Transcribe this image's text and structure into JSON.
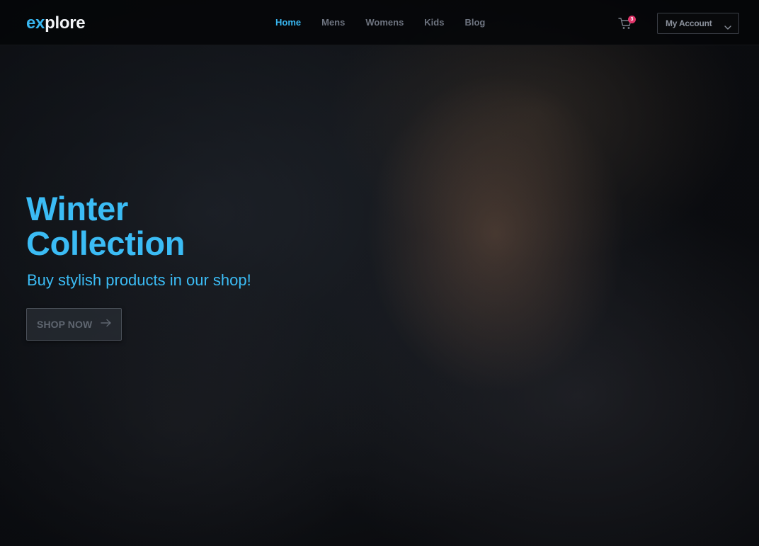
{
  "header": {
    "logo_prefix": "ex",
    "logo_rest": "plore",
    "nav": [
      {
        "label": "Home",
        "active": true
      },
      {
        "label": "Mens",
        "active": false
      },
      {
        "label": "Womens",
        "active": false
      },
      {
        "label": "Kids",
        "active": false
      },
      {
        "label": "Blog",
        "active": false
      }
    ],
    "cart": {
      "icon": "cart-icon",
      "count": "3"
    },
    "account": {
      "label": "My Account",
      "icon": "chevron-down-icon"
    }
  },
  "hero": {
    "title_line1": "Winter",
    "title_line2": "Collection",
    "subtitle": "Buy stylish products in our shop!",
    "cta_label": "SHOP NOW",
    "cta_icon": "arrow-right-icon",
    "image": "woman-in-fur-coat-photo"
  },
  "colors": {
    "accent": "#38b6f0",
    "badge": "#e0356a",
    "header_bg": "#050608"
  }
}
